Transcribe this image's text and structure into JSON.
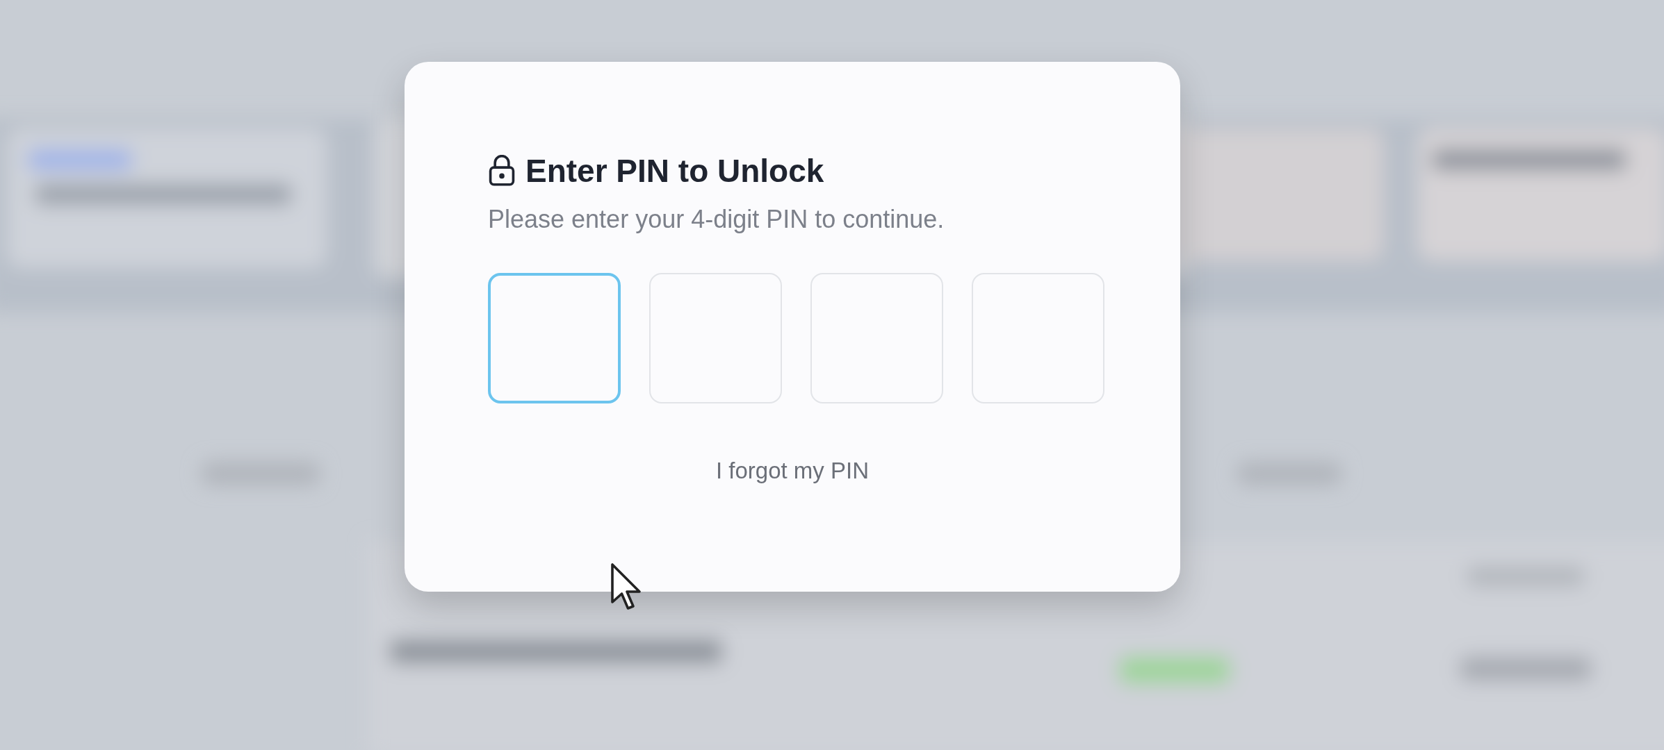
{
  "dialog": {
    "title": "Enter PIN to Unlock",
    "subtitle": "Please enter your 4-digit PIN to continue.",
    "pin_fields": [
      {
        "selected": true
      },
      {
        "selected": false
      },
      {
        "selected": false
      },
      {
        "selected": false
      }
    ],
    "forgot_link": "I forgot my PIN"
  }
}
